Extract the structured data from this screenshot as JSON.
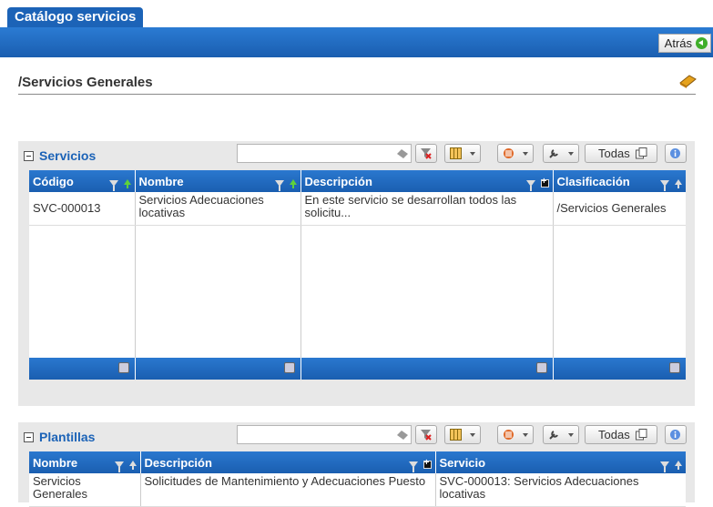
{
  "window": {
    "tab_title": "Catálogo servicios",
    "back_label": "Atrás"
  },
  "section": {
    "title": "/Servicios Generales"
  },
  "servicios": {
    "title": "Servicios",
    "search_value": "",
    "todas_label": "Todas",
    "columns": [
      "Código",
      "Nombre",
      "Descripción",
      "Clasificación"
    ],
    "rows": [
      {
        "codigo": "SVC-000013",
        "nombre": "Servicios Adecuaciones locativas",
        "descripcion": "En este servicio se desarrollan todos las solicitu...",
        "clasificacion": "/Servicios Generales"
      }
    ]
  },
  "plantillas": {
    "title": "Plantillas",
    "search_value": "",
    "todas_label": "Todas",
    "columns": [
      "Nombre",
      "Descripción",
      "Servicio"
    ],
    "rows": [
      {
        "nombre": "Servicios Generales",
        "descripcion": "Solicitudes de Mantenimiento y Adecuaciones Puesto",
        "servicio": "SVC-000013: Servicios Adecuaciones locativas"
      }
    ]
  },
  "colors": {
    "header_blue": "#1c63b7",
    "panel_gray": "#e8e8e8",
    "sort_green": "#5fd13b"
  }
}
